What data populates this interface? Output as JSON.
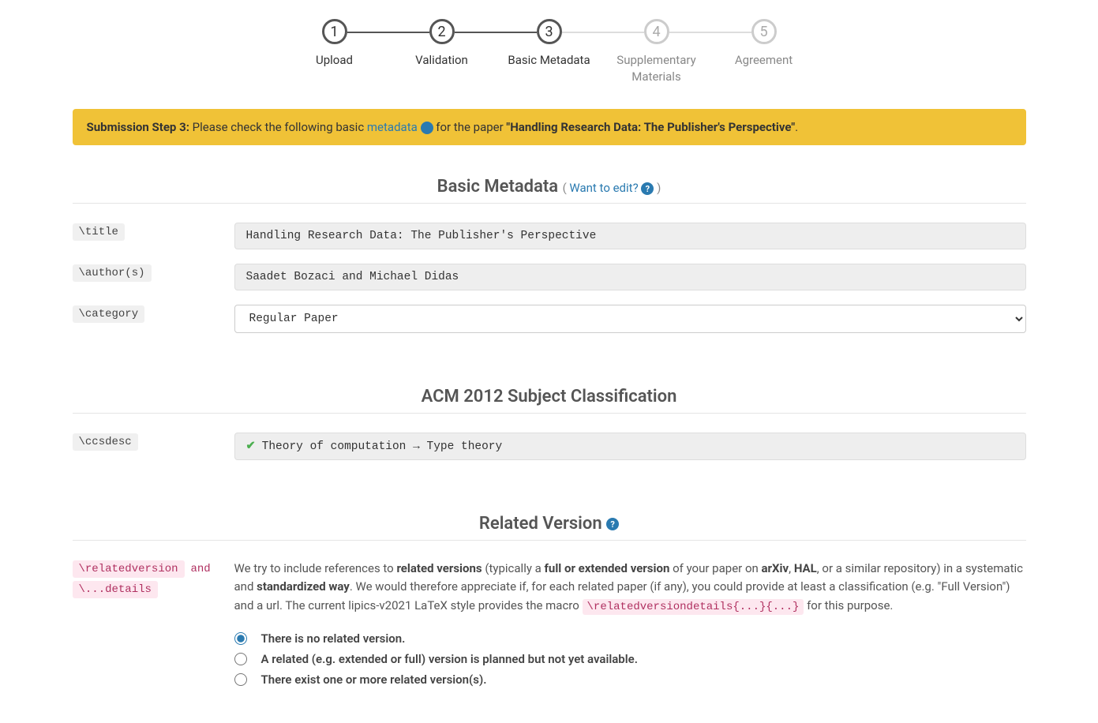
{
  "stepper": {
    "steps": [
      {
        "num": "1",
        "label": "Upload",
        "active": true
      },
      {
        "num": "2",
        "label": "Validation",
        "active": true
      },
      {
        "num": "3",
        "label": "Basic Metadata",
        "active": true
      },
      {
        "num": "4",
        "label": "Supplementary Materials",
        "active": false
      },
      {
        "num": "5",
        "label": "Agreement",
        "active": false
      }
    ]
  },
  "notice": {
    "prefix": "Submission Step 3:",
    "text1": " Please check the following basic ",
    "link": "metadata",
    "text2": " for the paper ",
    "title": "\"Handling Research Data: The Publisher's Perspective\"",
    "suffix": "."
  },
  "sections": {
    "basic": {
      "heading": "Basic Metadata",
      "edit_prefix": "( ",
      "edit_link": "Want to edit?",
      "edit_suffix": " )"
    },
    "acm": {
      "heading": "ACM 2012 Subject Classification"
    },
    "related": {
      "heading": "Related Version"
    }
  },
  "fields": {
    "title": {
      "label": "\\title",
      "value": "Handling Research Data: The Publisher's Perspective"
    },
    "authors": {
      "label": "\\author(s)",
      "value": "Saadet Bozaci and Michael Didas"
    },
    "category": {
      "label": "\\category",
      "value": "Regular Paper"
    },
    "ccsdesc": {
      "label": "\\ccsdesc",
      "value": "Theory of computation → Type theory"
    }
  },
  "related": {
    "label1": "\\relatedversion",
    "label_and": "and",
    "label2": "\\...details",
    "desc": {
      "t1": "We try to include references to ",
      "b1": "related versions",
      "t2": " (typically a ",
      "b2": "full or extended version",
      "t3": " of your paper on ",
      "b3": "arXiv",
      "t4": ", ",
      "b4": "HAL",
      "t5": ", or a similar repository) in a systematic and ",
      "b5": "standardized way",
      "t6": ". We would therefore appreciate if, for each related paper (if any), you could provide at least a classification (e.g. \"Full Version\") and a url. The current lipics-v2021 LaTeX style provides the macro ",
      "code": "\\relatedversiondetails{...}{...}",
      "t7": " for this purpose."
    },
    "radios": {
      "r1": "There is no related version.",
      "r2": "A related (e.g. extended or full) version is planned but not yet available.",
      "r3": "There exist one or more related version(s)."
    }
  }
}
